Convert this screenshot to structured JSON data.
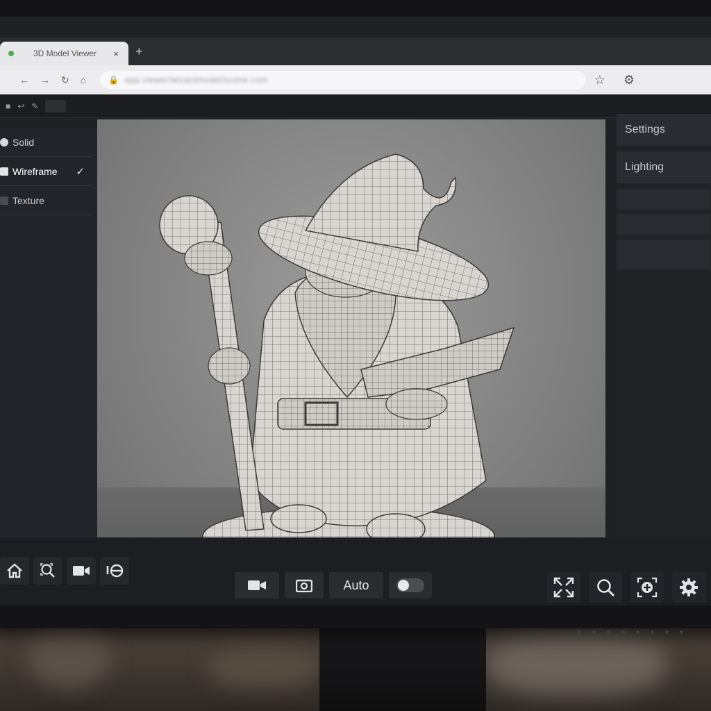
{
  "browser": {
    "tab_title": "3D Model Viewer",
    "tab_close": "×",
    "new_tab": "+",
    "url": "app.viewer/wizardmodel/scene.com"
  },
  "left_panel": {
    "modes": [
      {
        "label": "Solid",
        "selected": false
      },
      {
        "label": "Wireframe",
        "selected": true,
        "check": "✓"
      },
      {
        "label": "Texture",
        "selected": false
      }
    ]
  },
  "right_panel": {
    "settings_label": "Settings",
    "lighting_label": "Lighting"
  },
  "bottom_bar": {
    "auto_label": "Auto",
    "auto_toggle_on": false
  },
  "colors": {
    "panel_bg": "#23252a",
    "viewport_bg": "#8c8c8c",
    "accent_text": "#e8e8ea"
  }
}
